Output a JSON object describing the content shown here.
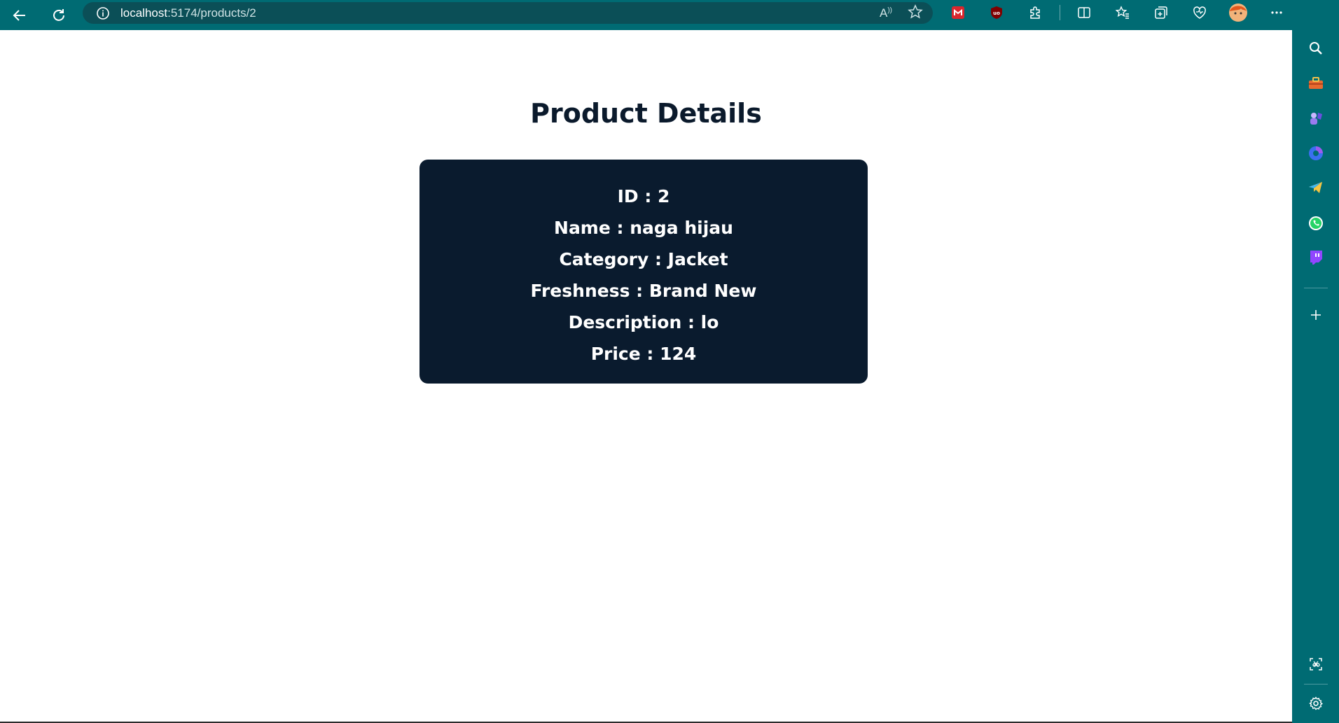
{
  "browser": {
    "url_host": "localhost",
    "url_path": ":5174/products/2",
    "read_aloud_label": "A",
    "toolbar_icons": [
      "read-aloud-icon",
      "favorite-star-icon",
      "extension-mega-icon",
      "ublock-icon",
      "extensions-puzzle-icon",
      "split-screen-icon",
      "favorites-icon",
      "collections-icon",
      "browser-essentials-icon",
      "profile-avatar-icon",
      "more-options-icon",
      "copilot-icon"
    ],
    "sidebar_icons": [
      "search-icon",
      "tools-icon",
      "games-icon",
      "copilot-sidebar-icon",
      "telegram-icon",
      "whatsapp-icon",
      "twitch-icon",
      "add-icon",
      "screenshot-icon",
      "settings-icon"
    ]
  },
  "page": {
    "title": "Product Details"
  },
  "product": {
    "id": "ID : 2",
    "name": "Name : naga hijau",
    "category": "Category : Jacket",
    "freshness": "Freshness : Brand New",
    "description": "Description : lo",
    "price": "Price : 124"
  },
  "colors": {
    "browser_chrome": "#006b73",
    "card_bg": "#0a1b2e",
    "title": "#0b1a2c"
  }
}
